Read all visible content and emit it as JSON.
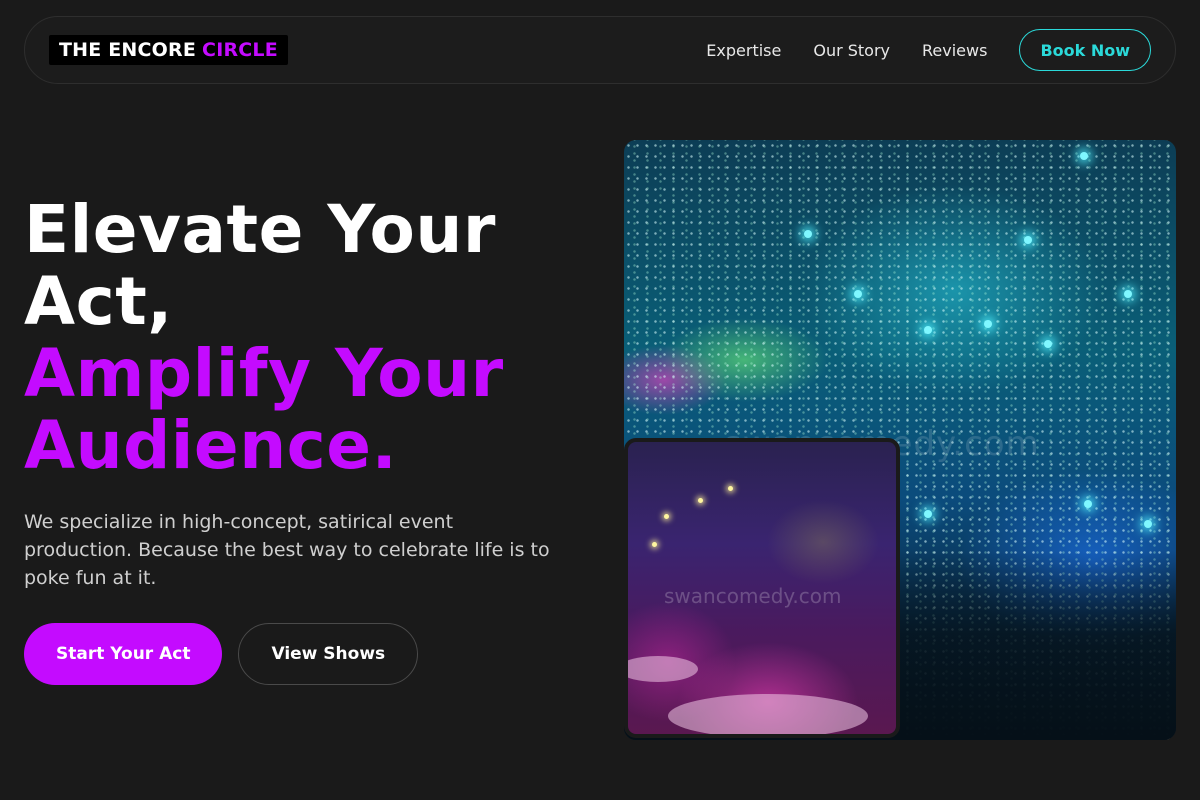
{
  "nav": {
    "logo_main": "THE ENCORE",
    "logo_accent": "CIRCLE",
    "links": [
      "Expertise",
      "Our Story",
      "Reviews"
    ],
    "cta": "Book Now"
  },
  "hero": {
    "headline_line1a": "Elevate Your",
    "headline_line1b": "Act,",
    "headline_line2a": "Amplify Your",
    "headline_line2b": "Audience.",
    "subtext": "We specialize in high-concept, satirical event production. Because the best way to celebrate life is to poke fun at it.",
    "primary_cta": "Start Your Act",
    "secondary_cta": "View Shows"
  },
  "images": {
    "main_watermark": "swancomedy.com",
    "inset_watermark": "swancomedy.com"
  },
  "colors": {
    "background": "#1a1a1a",
    "accent_purple": "#c40bff",
    "accent_cyan": "#2bd9d9"
  }
}
